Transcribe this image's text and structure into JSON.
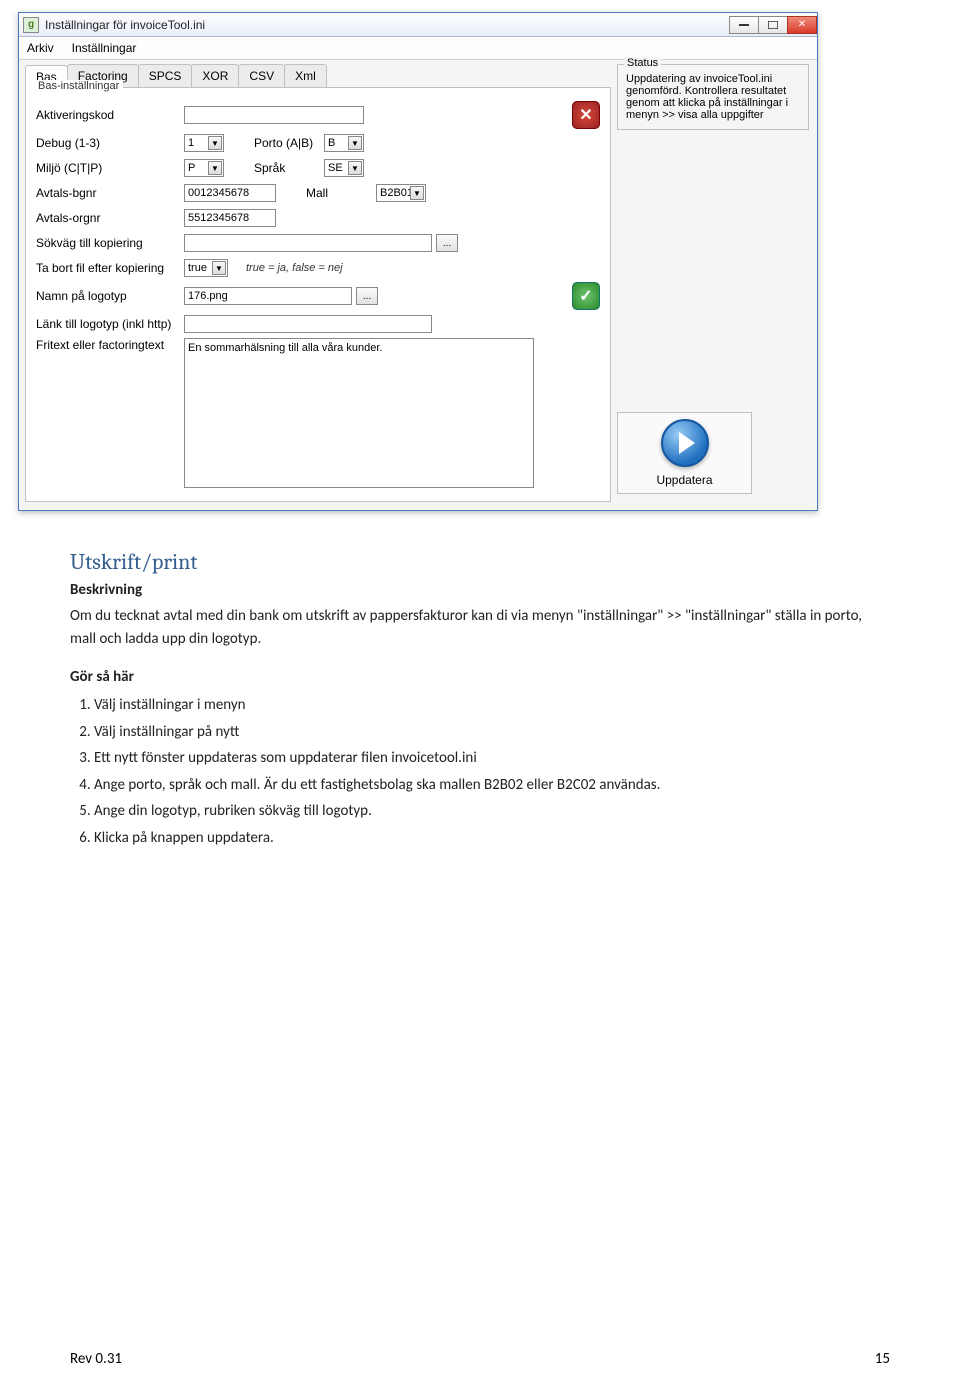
{
  "window": {
    "title": "Inställningar för invoiceTool.ini",
    "app_icon_letter": "g"
  },
  "menu": {
    "items": [
      "Arkiv",
      "Inställningar"
    ]
  },
  "tabs": [
    "Bas",
    "Factoring",
    "SPCS",
    "XOR",
    "CSV",
    "Xml"
  ],
  "group_title": "Bas-inställningar",
  "labels": {
    "aktiveringskod": "Aktiveringskod",
    "debug": "Debug (1-3)",
    "miljo": "Miljö (C|T|P)",
    "avtals_bgnr": "Avtals-bgnr",
    "avtals_orgnr": "Avtals-orgnr",
    "sokvag_kopiering": "Sökväg till kopiering",
    "tabort": "Ta bort fil efter kopiering",
    "namn_logotyp": "Namn på logotyp",
    "lank_logotyp": "Länk till logotyp (inkl http)",
    "fritext": "Fritext eller factoringtext",
    "porto": "Porto (A|B)",
    "sprak": "Språk",
    "mall": "Mall"
  },
  "values": {
    "aktiveringskod": "",
    "debug": "1",
    "miljo": "P",
    "avtals_bgnr": "0012345678",
    "avtals_orgnr": "5512345678",
    "sokvag": "",
    "tabort": "true",
    "tabort_hint": "true = ja, false = nej",
    "namn_logotyp": "176.png",
    "lank_logotyp": "",
    "fritext_val": "En sommarhälsning till alla våra kunder.",
    "porto": "B",
    "sprak": "SE",
    "mall": "B2B01"
  },
  "status": {
    "legend": "Status",
    "text": "Uppdatering av invoiceTool.ini genomförd. Kontrollera resultatet genom att klicka på inställningar i menyn >> visa alla uppgifter"
  },
  "update_button": "Uppdatera",
  "doc": {
    "heading": "Utskrift/print",
    "desc_label": "Beskrivning",
    "desc_text": "Om du tecknat avtal med din bank om utskrift av pappersfakturor kan di via menyn \"inställningar\" >> \"inställningar\" ställa in porto, mall och ladda upp din logotyp.",
    "gor_label": "Gör så här",
    "steps": [
      "Välj inställningar i menyn",
      "Välj inställningar på nytt",
      "Ett nytt fönster uppdateras som uppdaterar filen invoicetool.ini",
      "Ange porto, språk och mall. Är du ett fastighetsbolag ska mallen B2B02 eller B2C02 användas.",
      "Ange din logotyp, rubriken sökväg till logotyp.",
      "Klicka på knappen uppdatera."
    ]
  },
  "footer": {
    "rev": "Rev 0.31",
    "page": "15"
  }
}
